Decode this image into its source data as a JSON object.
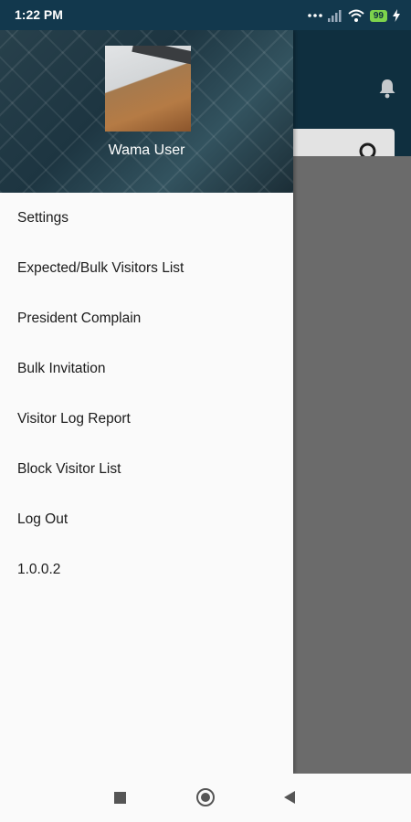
{
  "status_bar": {
    "time": "1:22 PM",
    "battery": "99",
    "icons": [
      "more-dots-icon",
      "signal-icon",
      "wifi-icon",
      "battery-icon",
      "charging-icon"
    ]
  },
  "drawer": {
    "user_name": "Wama User",
    "menu_items": [
      "Settings",
      "Expected/Bulk Visitors List",
      "President Complain",
      "Bulk Invitation",
      "Visitor Log Report",
      "Block Visitor List",
      "Log Out",
      "1.0.0.2"
    ]
  },
  "colors": {
    "status_bar": "#12384d",
    "header": "#0f2f3f",
    "scrim": "#6b6b6b",
    "battery": "#7dd34c"
  }
}
